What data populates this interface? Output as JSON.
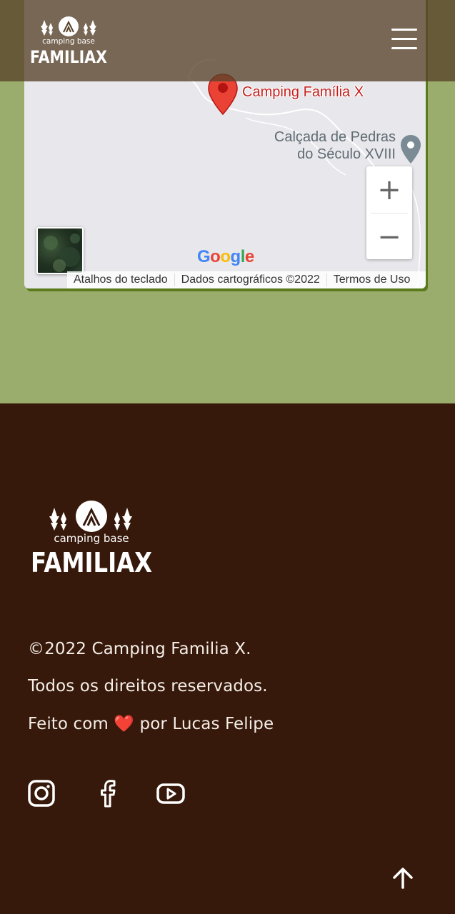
{
  "header": {
    "logo_line1": "camping base",
    "logo_line2": "FAMILIAX",
    "menu_icon": "hamburger-menu-icon"
  },
  "map": {
    "marker_label": "Camping Família X",
    "poi_line1": "Calçada de Pedras",
    "poi_line2": "do Século XVIII",
    "zoom_in": "+",
    "zoom_out": "−",
    "google_letters": [
      "G",
      "o",
      "o",
      "g",
      "l",
      "e"
    ],
    "google_colors": [
      "#4285F4",
      "#EA4335",
      "#FBBC05",
      "#4285F4",
      "#34A853",
      "#EA4335"
    ],
    "attribution": {
      "shortcuts": "Atalhos do teclado",
      "map_data": "Dados cartográficos ©2022",
      "terms": "Termos de Uso"
    },
    "colors": {
      "marker": "#ea4335",
      "background": "#e8e8ec"
    }
  },
  "footer": {
    "logo_line1": "camping base",
    "logo_line2": "FAMILIAX",
    "copyright": "©2022 Camping Familia X.",
    "rights": "Todos os direitos reservados.",
    "made_with_prefix": "Feito com",
    "heart": "❤️",
    "made_with_suffix": "por Lucas Felipe",
    "social_icons": [
      "instagram-icon",
      "facebook-icon",
      "youtube-icon"
    ],
    "back_to_top_icon": "arrow-up-icon",
    "colors": {
      "background": "#36190b",
      "text": "#f4ede6"
    }
  },
  "page": {
    "colors": {
      "band": "#9bad6c",
      "header_overlay": "#58422a"
    }
  }
}
